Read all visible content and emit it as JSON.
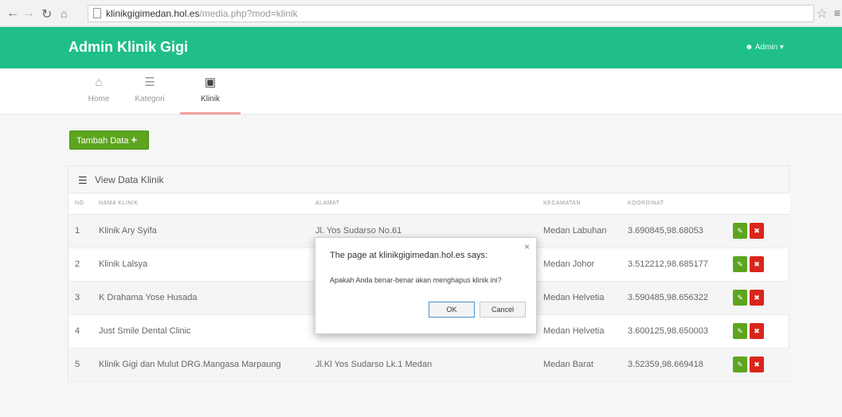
{
  "browser": {
    "url_host": "klinikgigimedan.hol.es",
    "url_path": "/media.php?mod=klinik"
  },
  "header": {
    "brand": "Admin Klinik Gigi",
    "user": "Admin"
  },
  "tabs": [
    {
      "label": "Home",
      "icon": "home-icon"
    },
    {
      "label": "Kategori",
      "icon": "list-icon"
    },
    {
      "label": "Klinik",
      "icon": "window-icon"
    }
  ],
  "add_button": "Tambah Data",
  "panel_title": "View Data Klinik",
  "table": {
    "headers": [
      "NO",
      "NAMA KLINIK",
      "ALAMAT",
      "KECAMATAN",
      "KOORDINAT",
      ""
    ],
    "rows": [
      {
        "no": "1",
        "nama": "Klinik Ary Syifa",
        "alamat": "Jl. Yos Sudarso No.61",
        "kecamatan": "Medan Labuhan",
        "koordinat": "3.690845,98.68053"
      },
      {
        "no": "2",
        "nama": "Klinik Lalsya",
        "alamat": "",
        "kecamatan": "Medan Johor",
        "koordinat": "3.512212,98.685177"
      },
      {
        "no": "3",
        "nama": "K Drahama Yose Husada",
        "alamat": "",
        "kecamatan": "Medan Helvetia",
        "koordinat": "3.590485,98.656322"
      },
      {
        "no": "4",
        "nama": "Just Smile Dental Clinic",
        "alamat": "",
        "kecamatan": "Medan Helvetia",
        "koordinat": "3.600125,98.650003"
      },
      {
        "no": "5",
        "nama": "Klinik Gigi dan Mulut DRG.Mangasa Marpaung",
        "alamat": "Jl.Kl Yos Sudarso Lk.1 Medan",
        "kecamatan": "Medan Barat",
        "koordinat": "3.52359,98.669418"
      }
    ]
  },
  "dialog": {
    "title": "The page at klinikgigimedan.hol.es says:",
    "message": "Apakah Anda benar-benar akan menghapus klinik ini?",
    "ok": "OK",
    "cancel": "Cancel"
  }
}
